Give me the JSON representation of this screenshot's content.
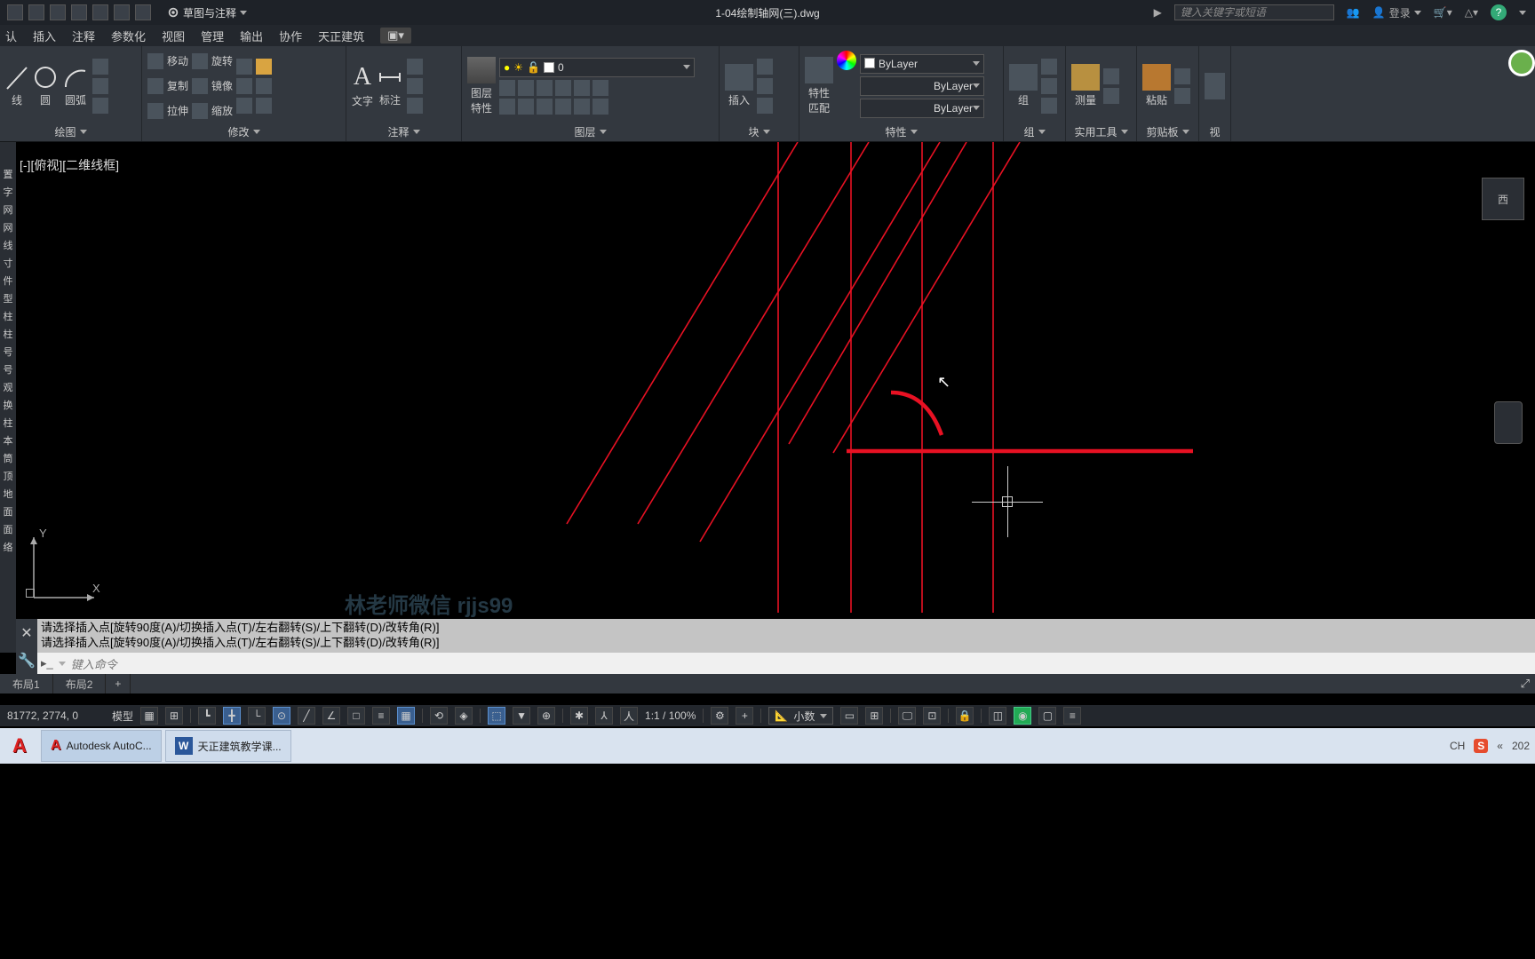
{
  "title": "1-04绘制轴网(三).dwg",
  "workspace": "草图与注释",
  "search_placeholder": "键入关键字或短语",
  "login": "登录",
  "menu": {
    "t0": "认",
    "t1": "插入",
    "t2": "注释",
    "t3": "参数化",
    "t4": "视图",
    "t5": "管理",
    "t6": "输出",
    "t7": "协作",
    "t8": "天正建筑"
  },
  "ribbon": {
    "draw": {
      "line": "线",
      "circle": "圆",
      "arc": "圆弧",
      "label": "绘图"
    },
    "modify": {
      "move": "移动",
      "rotate": "旋转",
      "copy": "复制",
      "mirror": "镜像",
      "stretch": "拉伸",
      "scale": "缩放",
      "label": "修改"
    },
    "annot": {
      "text": "文字",
      "dim": "标注",
      "label": "注释"
    },
    "layer": {
      "big": "图层\n特性",
      "combo": "0",
      "label": "图层"
    },
    "block": {
      "insert": "插入",
      "label": "块"
    },
    "prop": {
      "match": "特性\n匹配",
      "bylayer": "ByLayer",
      "label": "特性"
    },
    "group": {
      "big": "组",
      "label": "组"
    },
    "util": {
      "measure": "测量",
      "label": "实用工具"
    },
    "clip": {
      "paste": "粘贴",
      "label": "剪贴板"
    },
    "view": {
      "label": "视"
    }
  },
  "viewport_label": "[-][俯视][二维线框]",
  "ucs": {
    "y": "Y",
    "x": "X"
  },
  "watermark": "林老师微信 rjjs99",
  "left_items": [
    "置",
    "字",
    "网",
    "网",
    "线",
    "寸",
    "件",
    "型",
    "柱",
    "柱",
    "号",
    "号",
    "观",
    "换",
    "柱",
    "本",
    "筒",
    "顶",
    "地",
    "面",
    "面",
    "络"
  ],
  "cmd_hist1": "请选择插入点[旋转90度(A)/切换插入点(T)/左右翻转(S)/上下翻转(D)/改转角(R)]",
  "cmd_hist2": "请选择插入点[旋转90度(A)/切换插入点(T)/左右翻转(S)/上下翻转(D)/改转角(R)]",
  "cmd_placeholder": "键入命令",
  "tabs": {
    "layout1": "布局1",
    "layout2": "布局2"
  },
  "status": {
    "coords": "81772, 2774, 0",
    "model": "模型",
    "scale": "1:1 / 100%",
    "annoscale": "小数"
  },
  "taskbar": {
    "app1": "Autodesk AutoC...",
    "app2": "天正建筑教学课..."
  },
  "tray": {
    "ime": "CH",
    "year": "202"
  },
  "nav": {
    "west": "西"
  }
}
